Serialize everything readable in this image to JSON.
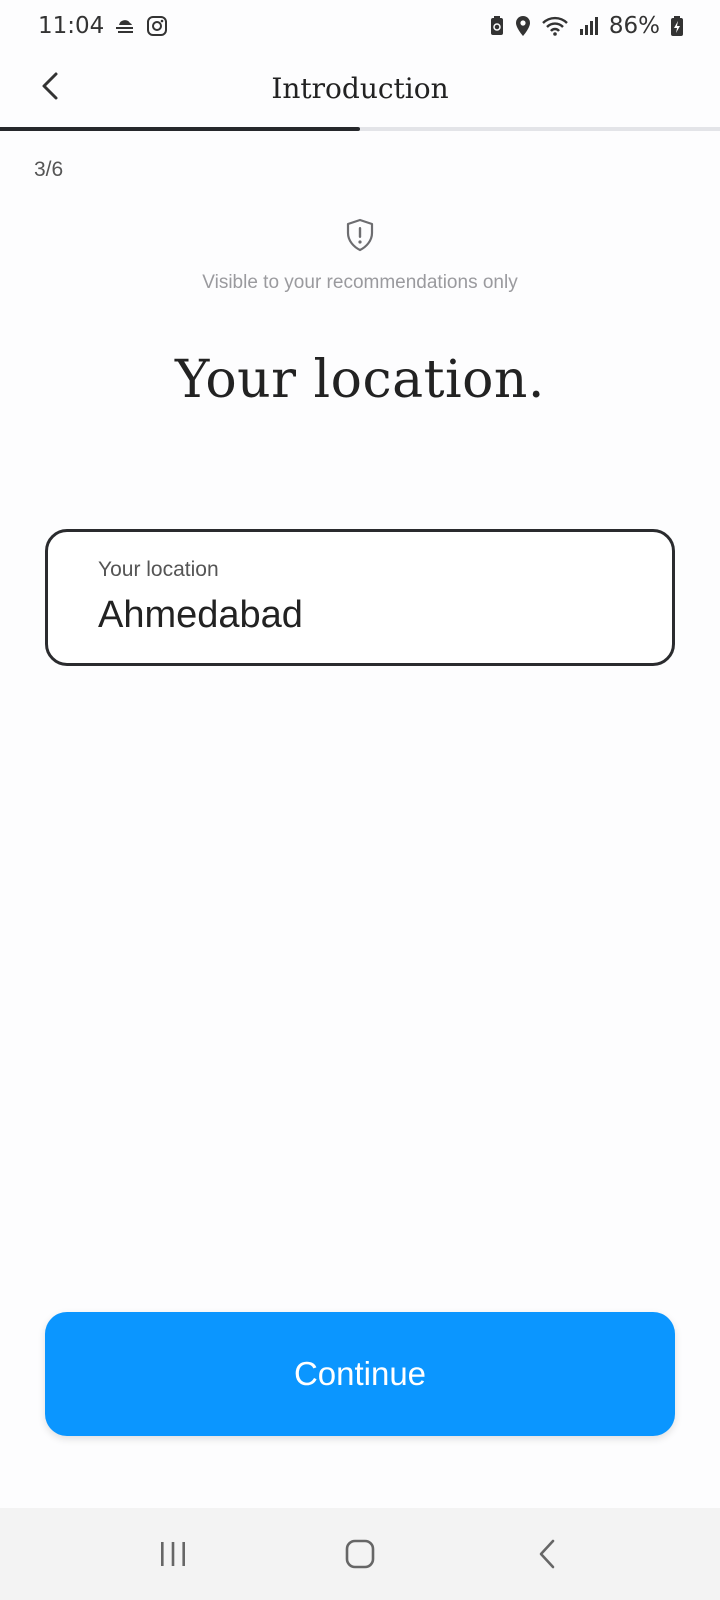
{
  "status_bar": {
    "time": "11:04",
    "battery": "86%",
    "icons_left": [
      "weather-fog-icon",
      "instagram-icon"
    ],
    "icons_right": [
      "battery-saver-icon",
      "location-pin-icon",
      "wifi-icon",
      "signal-icon",
      "battery-icon"
    ]
  },
  "header": {
    "title": "Introduction",
    "back_icon": "chevron-left-icon"
  },
  "progress": {
    "step_label": "3/6",
    "fraction": 0.5,
    "color": "#26282c",
    "track_color": "#e3e4e8"
  },
  "privacy": {
    "icon": "shield-alert-icon",
    "text": "Visible to your recommendations only"
  },
  "main": {
    "heading": "Your location."
  },
  "location_field": {
    "label": "Your location",
    "value": "Ahmedabad"
  },
  "continue_button": {
    "label": "Continue",
    "color": "#0b96ff"
  },
  "nav_bar": {
    "items": [
      "recent-apps-icon",
      "home-icon",
      "back-icon"
    ]
  }
}
